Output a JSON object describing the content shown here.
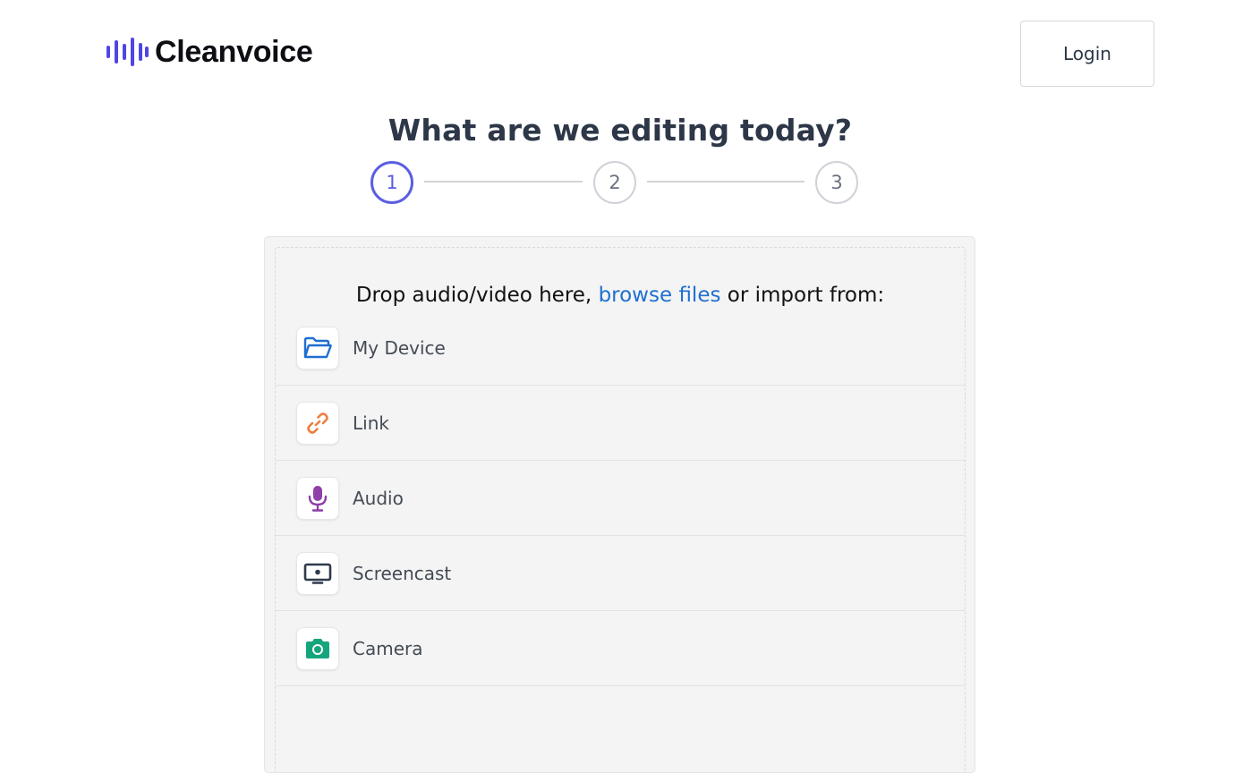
{
  "brand": {
    "name": "Cleanvoice",
    "accent_color": "#4f46e5",
    "logo_icon": "sound-wave-icon"
  },
  "header": {
    "login_label": "Login"
  },
  "main": {
    "title": "What are we editing today?",
    "stepper": {
      "current_step": 1,
      "steps": [
        "1",
        "2",
        "3"
      ]
    }
  },
  "upload": {
    "heading_before": "Drop audio/video here, ",
    "browse_link": "browse files",
    "heading_after": " or import from:",
    "sources": [
      {
        "label": "My Device",
        "icon": "folder-icon",
        "color": "#1f6fd1"
      },
      {
        "label": "Link",
        "icon": "link-icon",
        "color": "#ef7d3c"
      },
      {
        "label": "Audio",
        "icon": "microphone-icon",
        "color": "#8e3fa8"
      },
      {
        "label": "Screencast",
        "icon": "screencast-icon",
        "color": "#2f3a4a"
      },
      {
        "label": "Camera",
        "icon": "camera-icon",
        "color": "#14a57d"
      }
    ]
  }
}
